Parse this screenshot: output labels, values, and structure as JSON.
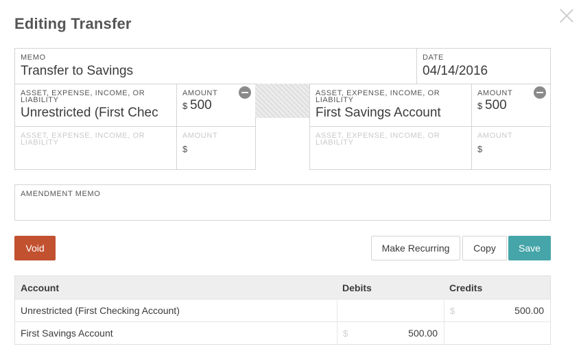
{
  "dialog": {
    "title": "Editing Transfer"
  },
  "memo": {
    "label": "MEMO",
    "value": "Transfer to Savings"
  },
  "date": {
    "label": "DATE",
    "value": "04/14/2016"
  },
  "left": {
    "account_label": "ASSET, EXPENSE, INCOME, OR LIABILITY",
    "account_value": "Unrestricted (First Chec",
    "amount_label": "AMOUNT",
    "currency": "$",
    "amount_value": "500",
    "empty_account_label": "ASSET, EXPENSE, INCOME, OR LIABILITY",
    "empty_amount_label": "AMOUNT",
    "empty_currency": "$"
  },
  "right": {
    "account_label": "ASSET, EXPENSE, INCOME, OR LIABILITY",
    "account_value": "First Savings Account",
    "amount_label": "AMOUNT",
    "currency": "$",
    "amount_value": "500",
    "empty_account_label": "ASSET, EXPENSE, INCOME, OR LIABILITY",
    "empty_amount_label": "AMOUNT",
    "empty_currency": "$"
  },
  "amendment": {
    "label": "AMENDMENT MEMO",
    "value": ""
  },
  "buttons": {
    "void": "Void",
    "make_recurring": "Make Recurring",
    "copy": "Copy",
    "save": "Save"
  },
  "table": {
    "headers": {
      "account": "Account",
      "debits": "Debits",
      "credits": "Credits"
    },
    "rows": [
      {
        "account": "Unrestricted (First Checking Account)",
        "debit": "",
        "credit": "500.00",
        "currency": "$"
      },
      {
        "account": "First Savings Account",
        "debit": "500.00",
        "credit": "",
        "currency": "$"
      }
    ]
  },
  "colors": {
    "void": "#c2512f",
    "save": "#45a5a8"
  }
}
